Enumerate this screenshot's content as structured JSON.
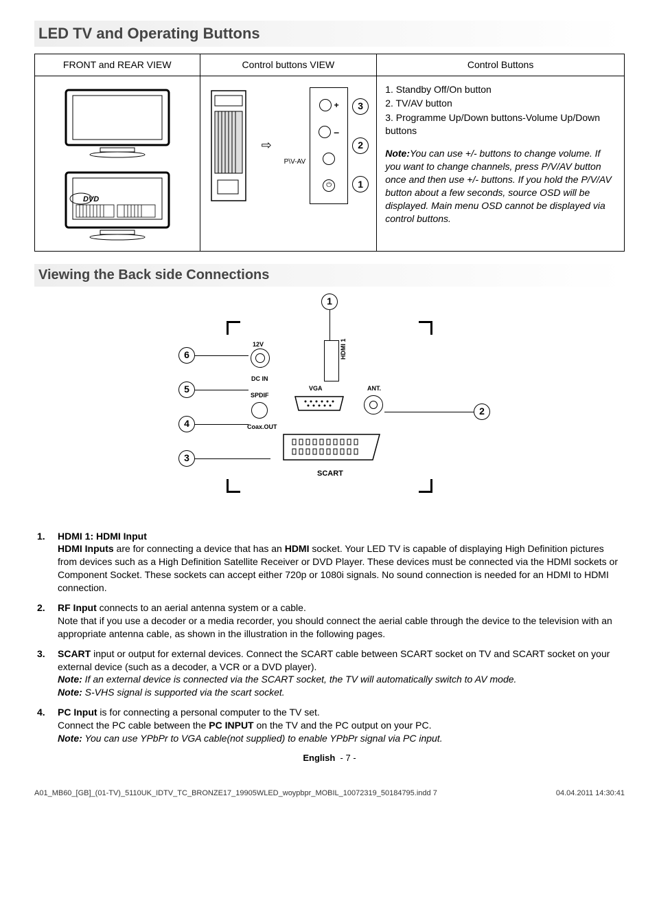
{
  "section1_title": "LED TV and Operating Buttons",
  "table": {
    "h_front": "FRONT and REAR VIEW",
    "h_ctrlview": "Control buttons VIEW",
    "h_ctrlbtns": "Control Buttons"
  },
  "ctrl": {
    "btn1": "1. Standby Off/On button",
    "btn2": "2. TV/AV button",
    "btn3": "3. Programme Up/Down buttons-Volume Up/Down buttons",
    "note_label": "Note:",
    "note_text": "You can use +/- buttons to change volume. If you want to change channels, press P/V/AV button once and then use +/- buttons. If you hold the P/V/AV button about a few seconds, source OSD will be displayed. Main menu OSD cannot be displayed via control buttons."
  },
  "diagram": {
    "plus": "+",
    "minus": "–",
    "pvav": "P\\V-AV",
    "power": "⏻",
    "n1": "1",
    "n2": "2",
    "n3": "3"
  },
  "section2_title": "Viewing the Back side Connections",
  "back": {
    "n1": "1",
    "n2": "2",
    "n3": "3",
    "n4": "4",
    "n5": "5",
    "n6": "6",
    "l_12v": "12V",
    "l_dcin": "DC IN",
    "l_spdif": "SPDIF",
    "l_coax": "Coax.OUT",
    "l_vga": "VGA",
    "l_ant": "ANT.",
    "l_hdmi": "HDMI 1",
    "l_scart": "SCART"
  },
  "items": [
    {
      "num": "1.",
      "bold": "HDMI 1: HDMI Input",
      "prefix": "HDMI Inputs",
      "text": " are for connecting a device that has an ",
      "bold2": "HDMI",
      "text2": " socket. Your LED TV is capable of displaying High Definition pictures from devices such as a High Definition Satellite Receiver or DVD Player. These devices must be connected via the HDMI sockets or Component Socket. These sockets can accept either 720p or 1080i signals. No sound connection is needed for an HDMI to HDMI connection."
    },
    {
      "num": "2.",
      "bold": "RF Input",
      "text": " connects to an aerial antenna system or a cable.",
      "para2": "Note that if you use a decoder or a media recorder, you should connect the aerial cable through the device to the television with an appropriate antenna cable, as shown in the illustration in the following pages."
    },
    {
      "num": "3.",
      "bold": "SCART",
      "text": "  input or output for external devices. Connect the SCART cable between SCART socket on TV and SCART socket on your external device (such as a decoder, a VCR or a DVD player).",
      "note1_l": "Note:",
      "note1": " If an external device is connected via the SCART socket, the TV will automatically switch to AV mode.",
      "note2_l": "Note:",
      "note2": " S-VHS signal is supported via the scart socket."
    },
    {
      "num": "4.",
      "bold": "PC Input",
      "text": " is for connecting a personal computer to the TV set.",
      "para2_pre": "Connect the PC cable between the ",
      "para2_b": "PC INPUT",
      "para2_post": " on the TV and the PC output on your PC.",
      "note_l": "Note:",
      "note": " You can use YPbPr to VGA cable(not supplied) to enable YPbPr signal via PC input."
    }
  ],
  "footer": {
    "lang": "English",
    "page": "- 7 -",
    "file": "A01_MB60_[GB]_(01-TV)_5110UK_IDTV_TC_BRONZE17_19905WLED_woypbpr_MOBIL_10072319_50184795.indd   7",
    "stamp": "04.04.2011   14:30:41"
  }
}
